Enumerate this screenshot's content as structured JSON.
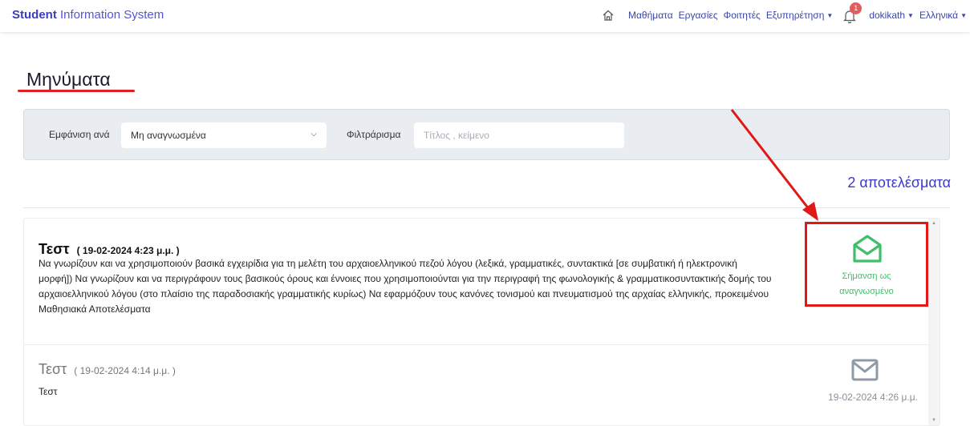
{
  "navbar": {
    "brand_bold": "Student",
    "brand_light": "Information System",
    "items": [
      "Μαθήματα",
      "Εργασίες",
      "Φοιτητές",
      "Εξυπηρέτηση"
    ],
    "notification_count": "1",
    "user": "dokikath",
    "language": "Ελληνικά",
    "icons": [
      "home-icon",
      "bell-icon",
      "chevron-down-icon"
    ]
  },
  "page": {
    "title": "Μηνύματα"
  },
  "filter": {
    "show_by_label": "Εμφάνιση ανά",
    "show_by_value": "Μη αναγνωσμένα",
    "filter_label": "Φιλτράρισμα",
    "search_placeholder": "Τίτλος , κείμενο"
  },
  "results": {
    "count_text": "2 αποτελέσματα"
  },
  "messages": [
    {
      "title": "Τεστ",
      "date": "( 19-02-2024 4:23 μ.μ. )",
      "body": "Να γνωρίζουν και να χρησιμοποιούν βασικά εγχειρίδια για τη μελέτη του αρχαιοελληνικού πεζού λόγου (λεξικά, γραμματικές, συντακτικά [σε συμβατική ή ηλεκτρονική μορφή]) Να γνωρίζουν και να περιγράφουν τους βασικούς όρους και έννοιες που χρησιμοποιούνται για την περιγραφή της φωνολογικής & γραμματικοσυντακτικής δομής του αρχαιοελληνικού λόγου (στο πλαίσιο της παραδοσιακής γραμματικής κυρίως) Να εφαρμόζουν τους κανόνες τονισμού και πνευματισμού της αρχαίας ελληνικής, προκειμένου Μαθησιακά Αποτελέσματα",
      "unread": true,
      "action_label_line1": "Σήμανση ως",
      "action_label_line2": "αναγνωσμένο",
      "icon": "envelope-open-icon"
    },
    {
      "title": "Τεστ",
      "date": "( 19-02-2024 4:14 μ.μ. )",
      "body": "Τεστ",
      "unread": false,
      "read_date": "19-02-2024 4:26 μ.μ.",
      "icon": "envelope-icon"
    }
  ],
  "colors": {
    "brand": "#3b3bc4",
    "accent_green": "#3fbf6a",
    "annotation_red": "#e01818",
    "nav_link": "#3a46a8"
  }
}
